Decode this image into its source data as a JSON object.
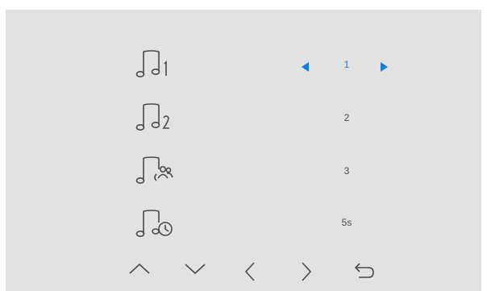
{
  "settings": {
    "rows": [
      {
        "icon": "ringtone-1-icon",
        "value": "1",
        "selected": true
      },
      {
        "icon": "ringtone-2-icon",
        "value": "2",
        "selected": false
      },
      {
        "icon": "intercom-ringtone-icon",
        "value": "3",
        "selected": false
      },
      {
        "icon": "ring-duration-icon",
        "value": "5s",
        "selected": false
      }
    ],
    "selector_icons": [
      "decrease-arrow-icon",
      "increase-arrow-icon"
    ]
  },
  "nav": {
    "buttons": [
      "up-icon",
      "down-icon",
      "left-icon",
      "right-icon",
      "back-icon"
    ]
  },
  "colors": {
    "background": "#e2e2e2",
    "accent": "#1a7fd8",
    "icon_stroke": "#4a4a4a"
  }
}
